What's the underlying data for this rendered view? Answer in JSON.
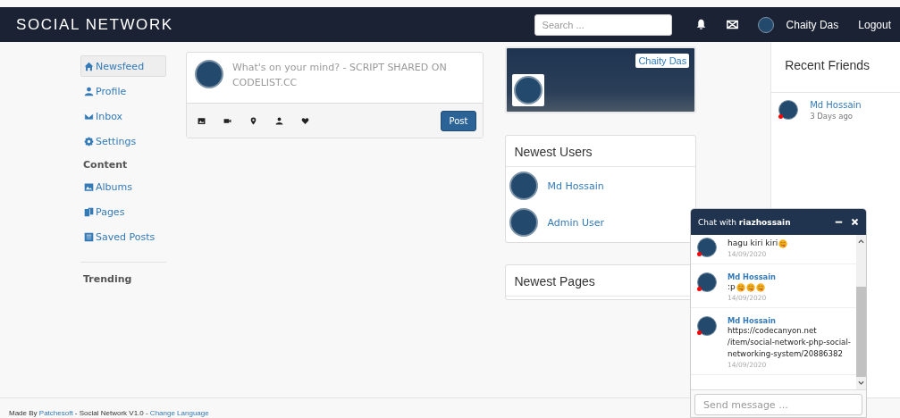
{
  "navbar": {
    "brand": "SOCIAL NETWORK",
    "search": {
      "placeholder": "Search ..."
    },
    "user_name": "Chaity Das",
    "logout": "Logout"
  },
  "sidebar": {
    "items": [
      {
        "label": "Newsfeed",
        "kind": "home",
        "selected": true
      },
      {
        "label": "Profile",
        "kind": "user",
        "selected": false
      },
      {
        "label": "Inbox",
        "kind": "mail",
        "selected": false
      },
      {
        "label": "Settings",
        "kind": "gear",
        "selected": false
      }
    ],
    "content_heading": "Content",
    "content_items": [
      {
        "label": "Albums",
        "kind": "picture",
        "selected": false
      },
      {
        "label": "Pages",
        "kind": "pages",
        "selected": false
      },
      {
        "label": "Saved Posts",
        "kind": "list",
        "selected": false
      }
    ],
    "trending_heading": "Trending"
  },
  "composer": {
    "placeholder": "What's on your mind? - SCRIPT SHARED ON CODELIST.CC",
    "post_button": "Post"
  },
  "profile_card": {
    "name": "Chaity Das"
  },
  "newest_users": {
    "title": "Newest Users",
    "users": [
      "Md Hossain",
      "Admin User"
    ]
  },
  "newest_pages": {
    "title": "Newest Pages"
  },
  "recent_friends": {
    "title": "Recent Friends",
    "friends": [
      {
        "name": "Md Hossain",
        "time": "3 Days ago",
        "color": "#ff0000"
      }
    ]
  },
  "chat": {
    "title_prefix": "Chat with ",
    "username": "riazhossain",
    "messages": [
      {
        "text": "hagu kiri kiri",
        "emojis": [
          {
            "kind": "tongue"
          }
        ],
        "date": "14/09/2020",
        "color": "#ff0000"
      },
      {
        "name": "Md Hossain",
        "text": ":p",
        "emojis": [
          {
            "kind": "tongue"
          },
          {
            "kind": "tongue"
          },
          {
            "kind": "tongue"
          }
        ],
        "date": "14/09/2020",
        "color": "#ff0000"
      },
      {
        "name": "Md Hossain",
        "text": "https://codecanyon.net /item/social-network-php-social-networking-system/20886382",
        "date": "14/09/2020",
        "color": "#ff0000"
      }
    ],
    "input": {
      "placeholder": "Send message ..."
    }
  },
  "footer": {
    "prefix": "Made By ",
    "author": "Patchesoft",
    "middle": " - Social Network V1.0 - ",
    "language_link": "Change Language"
  }
}
